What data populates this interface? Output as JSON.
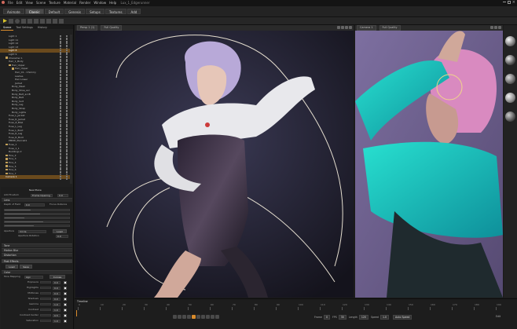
{
  "titlebar": {
    "title": "Lux_1_Edgerunner"
  },
  "menubar": {
    "items": [
      "File",
      "Edit",
      "View",
      "Scene",
      "Texture",
      "Material",
      "Render",
      "Window",
      "Help"
    ]
  },
  "workspace_tabs": [
    {
      "label": "Animate",
      "active": false
    },
    {
      "label": "Classic",
      "active": true
    },
    {
      "label": "Default",
      "active": false
    },
    {
      "label": "Genesis",
      "active": false
    },
    {
      "label": "Setups",
      "active": false
    },
    {
      "label": "Textures",
      "active": false
    },
    {
      "label": "Add",
      "active": false
    }
  ],
  "scene_panel": {
    "tabs": [
      {
        "label": "Scene",
        "active": true
      },
      {
        "label": "Tool Settings",
        "active": false
      },
      {
        "label": "History",
        "active": false
      }
    ],
    "tree": [
      {
        "label": "Light 1",
        "indent": 2,
        "folder": false
      },
      {
        "label": "Light 11",
        "indent": 2,
        "folder": false
      },
      {
        "label": "Light 12",
        "indent": 2,
        "folder": false
      },
      {
        "label": "Light 13",
        "indent": 2,
        "folder": false
      },
      {
        "label": "Light 8",
        "indent": 2,
        "folder": false,
        "selected": true
      },
      {
        "label": "Light 9",
        "indent": 2,
        "folder": false
      },
      {
        "label": "Character 1",
        "indent": 1,
        "folder": true
      },
      {
        "label": "Hair_1_Body",
        "indent": 2,
        "folder": false
      },
      {
        "label": "Hair_Upper",
        "indent": 2,
        "folder": true
      },
      {
        "label": "Hair_Upper",
        "indent": 3,
        "folder": true
      },
      {
        "label": "Hair_01 - Chimmy",
        "indent": 4,
        "folder": false
      },
      {
        "label": "Lashes",
        "indent": 4,
        "folder": false
      },
      {
        "label": "Hair Lower",
        "indent": 4,
        "folder": false
      },
      {
        "label": "Jacket",
        "indent": 4,
        "folder": false
      },
      {
        "label": "Body_Mesh",
        "indent": 3,
        "folder": false
      },
      {
        "label": "Body_Shoe_acc",
        "indent": 3,
        "folder": false
      },
      {
        "label": "Body_Belt_accB",
        "indent": 3,
        "folder": false
      },
      {
        "label": "Body_Belt",
        "indent": 3,
        "folder": false
      },
      {
        "label": "Body_Suit",
        "indent": 3,
        "folder": false
      },
      {
        "label": "Body_Leg",
        "indent": 3,
        "folder": false
      },
      {
        "label": "Body_Strap",
        "indent": 3,
        "folder": false
      },
      {
        "label": "Body_Lights",
        "indent": 3,
        "folder": false
      },
      {
        "label": "Fuse_L_Jacket",
        "indent": 2,
        "folder": false
      },
      {
        "label": "Fuse_R_Jacket",
        "indent": 2,
        "folder": false
      },
      {
        "label": "Fuse_Z_Blaz",
        "indent": 2,
        "folder": false
      },
      {
        "label": "Fuse_L_Leg",
        "indent": 2,
        "folder": false
      },
      {
        "label": "Fuse_L_Boot",
        "indent": 2,
        "folder": false
      },
      {
        "label": "Fuse_R_Leg",
        "indent": 2,
        "folder": false
      },
      {
        "label": "Fuse_R_Boot",
        "indent": 2,
        "folder": false
      },
      {
        "label": "PMND_Pierce01",
        "indent": 2,
        "folder": false
      },
      {
        "label": "Fuse_1",
        "indent": 1,
        "folder": true
      },
      {
        "label": "Fuse_1_1",
        "indent": 2,
        "folder": false
      },
      {
        "label": "Buildings 2",
        "indent": 2,
        "folder": false
      },
      {
        "label": "Fine_2",
        "indent": 1,
        "folder": true
      },
      {
        "label": "Fine_3",
        "indent": 1,
        "folder": true
      },
      {
        "label": "Fine_4",
        "indent": 1,
        "folder": true
      },
      {
        "label": "Fine_5",
        "indent": 1,
        "folder": true
      },
      {
        "label": "Fine_6",
        "indent": 1,
        "folder": true
      },
      {
        "label": "Fine_7",
        "indent": 1,
        "folder": true
      },
      {
        "label": "Camera 1",
        "indent": 1,
        "folder": false,
        "selected": true
      }
    ]
  },
  "camera_panel": {
    "header": "New Plane",
    "row1_left": "Add Frustum",
    "row1_right": "Frame Opening",
    "row1_val": "0.0",
    "sections": {
      "lens": "Lens",
      "tone": "Tone",
      "motion_blur": "Motion Blur",
      "distortion": "Distortion",
      "post": "Post Effects",
      "color": "Color"
    },
    "depth_of_field": "Depth of Field",
    "dof_value": "0.0",
    "dof_right": "Focus distance",
    "aperture_label": "Aperture",
    "aperture_value": "Circle",
    "load_label": "Load",
    "aperture_rotation": "Aperture Rotation",
    "aperture_rotation_val": "0.0",
    "load_btn": "Load",
    "save_btn": "Save",
    "tone_mapping": "Tone Mapping",
    "tone_mapping_val": "Agx",
    "curves_btn": "Curves",
    "color_props": [
      {
        "label": "Exposure",
        "value": "0.0"
      },
      {
        "label": "Highlights",
        "value": "0.0"
      },
      {
        "label": "Midtones",
        "value": "0.0"
      },
      {
        "label": "Shadows",
        "value": "0.0"
      },
      {
        "label": "Gamma",
        "value": "1.0"
      },
      {
        "label": "Contrast",
        "value": "1.0"
      },
      {
        "label": "Contrast Center",
        "value": "0.5"
      },
      {
        "label": "Saturation",
        "value": "1.0"
      }
    ]
  },
  "viewport1": {
    "camera": "Persp 1 (1)",
    "quality": "Full Quality"
  },
  "viewport2": {
    "camera": "Camera 1",
    "quality": "Full Quality"
  },
  "timeline": {
    "title": "Timeline",
    "ticks": [
      "0",
      "10",
      "20",
      "30",
      "40",
      "50",
      "60",
      "70",
      "80",
      "90",
      "100",
      "110",
      "120",
      "130",
      "140",
      "150",
      "160",
      "170",
      "180",
      "190"
    ],
    "frame_label": "Frame",
    "frame_val": "0",
    "fps_label": "FPS",
    "fps_val": "30",
    "length_label": "Length",
    "length_val": "120",
    "speed_label": "Speed",
    "speed_val": "1.0",
    "auto_speed": "Auto Speed",
    "edit_label": "Edit"
  },
  "colors": {
    "accent": "#d88b2c",
    "selection": "#6a4a1d",
    "panel": "#202020",
    "viewport_bg": "#1f1e2c"
  }
}
